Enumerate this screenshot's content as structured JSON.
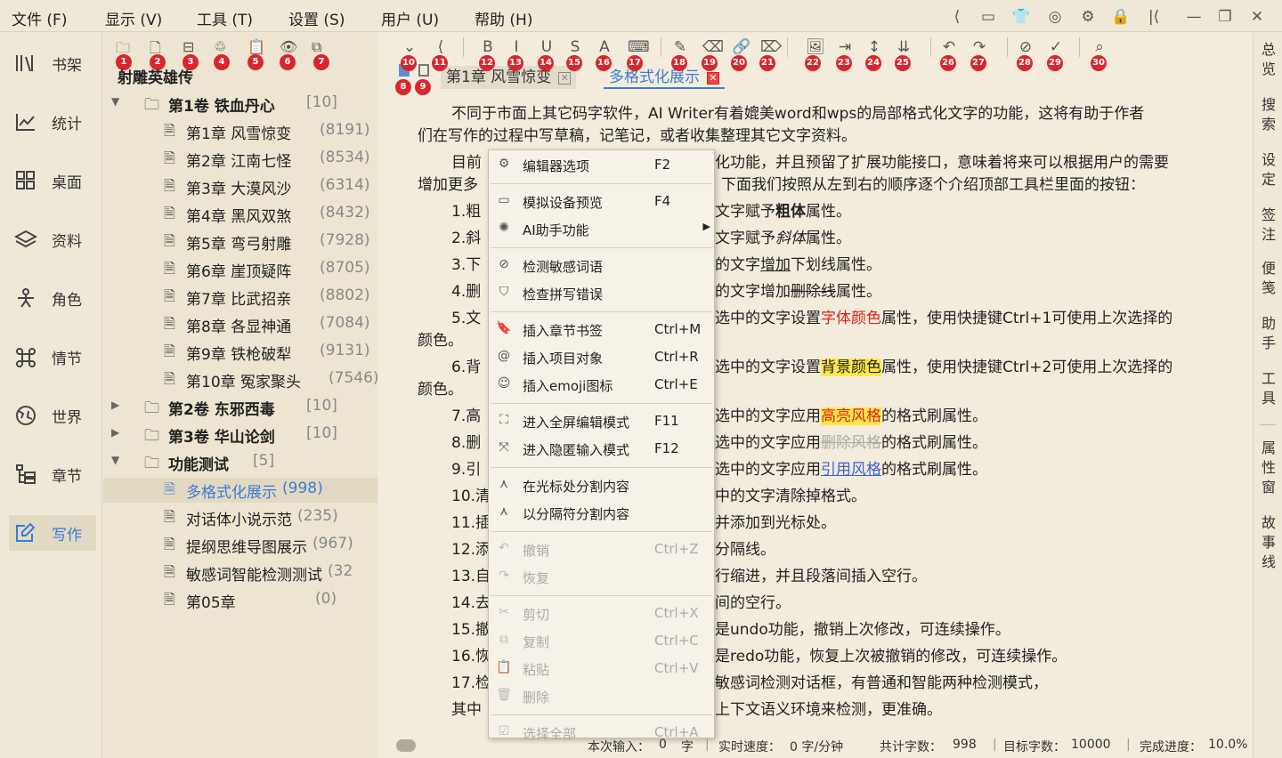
{
  "menu": [
    "文件 (F)",
    "显示 (V)",
    "工具 (T)",
    "设置 (S)",
    "用户 (U)",
    "帮助 (H)"
  ],
  "window_icons": [
    "first-page-icon",
    "sidebar-toggle-icon",
    "shirt-icon",
    "user-circle-icon",
    "gear-icon",
    "lock-icon",
    "collapse-icon",
    "minimize-icon",
    "maximize-icon",
    "close-icon"
  ],
  "nav": [
    {
      "label": "书架",
      "icon": "bookshelf-icon"
    },
    {
      "label": "统计",
      "icon": "chart-icon"
    },
    {
      "label": "桌面",
      "icon": "desktop-icon"
    },
    {
      "label": "资料",
      "icon": "layers-icon"
    },
    {
      "label": "角色",
      "icon": "person-icon"
    },
    {
      "label": "情节",
      "icon": "command-icon"
    },
    {
      "label": "世界",
      "icon": "globe-icon"
    },
    {
      "label": "章节",
      "icon": "chapters-icon"
    },
    {
      "label": "写作",
      "icon": "write-icon"
    }
  ],
  "tree_toolbar_badges": [
    "1",
    "2",
    "3",
    "4",
    "5",
    "6",
    "7"
  ],
  "book_title": "射雕英雄传",
  "tree": [
    {
      "type": "volume",
      "expanded": true,
      "label": "第1卷 铁血丹心",
      "count": "[10]"
    },
    {
      "type": "chapter",
      "label": "第1章 风雪惊变",
      "count": "(8191)"
    },
    {
      "type": "chapter",
      "label": "第2章 江南七怪",
      "count": "(8534)"
    },
    {
      "type": "chapter",
      "label": "第3章 大漠风沙",
      "count": "(6314)"
    },
    {
      "type": "chapter",
      "label": "第4章 黑风双煞",
      "count": "(8432)"
    },
    {
      "type": "chapter",
      "label": "第5章 弯弓射雕",
      "count": "(7928)"
    },
    {
      "type": "chapter",
      "label": "第6章 崖顶疑阵",
      "count": "(8705)"
    },
    {
      "type": "chapter",
      "label": "第7章 比武招亲",
      "count": "(8802)"
    },
    {
      "type": "chapter",
      "label": "第8章 各显神通",
      "count": "(7084)"
    },
    {
      "type": "chapter",
      "label": "第9章 铁枪破犁",
      "count": "(9131)"
    },
    {
      "type": "chapter",
      "label": "第10章 冤家聚头",
      "count": "(7546)"
    },
    {
      "type": "volume",
      "expanded": false,
      "label": "第2卷 东邪西毒",
      "count": "[10]"
    },
    {
      "type": "volume",
      "expanded": false,
      "label": "第3卷 华山论剑",
      "count": "[10]"
    },
    {
      "type": "volume",
      "expanded": true,
      "label": "功能测试",
      "count": "[5]"
    },
    {
      "type": "chapter",
      "selected": true,
      "label": "多格式化展示",
      "count": "(998)"
    },
    {
      "type": "chapter",
      "label": "对话体小说示范",
      "count": "(235)"
    },
    {
      "type": "chapter",
      "label": "提纲思维导图展示",
      "count": "(967)"
    },
    {
      "type": "chapter",
      "label": "敏感词智能检测测试",
      "count": "(32"
    },
    {
      "type": "chapter",
      "label": "第05章",
      "count": "(0)"
    }
  ],
  "editor_toolbar_badges": [
    "10",
    "11",
    "12",
    "13",
    "14",
    "15",
    "16",
    "17",
    "18",
    "19",
    "20",
    "21",
    "22",
    "23",
    "24",
    "25",
    "26",
    "27",
    "28",
    "29",
    "30"
  ],
  "tab_badges": [
    "8",
    "9"
  ],
  "tabs": [
    {
      "label": "第1章 风雪惊变",
      "active": false
    },
    {
      "label": "多格式化展示",
      "active": true
    }
  ],
  "editor": {
    "p1a": "不同于市面上其它码字软件，AI Writer有着媲美word和wps的局部格式化文字的功能，这将有助于作者",
    "p1b": "们在写作的过程中写草稿，记笔记，或者收集整理其它文字资料。",
    "p2a_left": "目前",
    "p2a_right": "化功能，并且预留了扩展功能接口，意味着将来可以根据用户的需要",
    "p2b_left": "增加更多",
    "p2b_right": "下面我们按照从左到右的顺序逐个介绍顶部工具栏里面的按钮：",
    "lines": [
      {
        "left": "1.粗",
        "right_pre": "文字赋予",
        "right_mark": "粗体",
        "right_post": "属性。",
        "style": "bold"
      },
      {
        "left": "2.斜",
        "right_pre": "文字赋予",
        "right_mark": "斜体",
        "right_post": "属性。",
        "style": "italic"
      },
      {
        "left": "3.下",
        "right_pre": "的文字",
        "right_mark": "增加",
        "right_post": "下划线属性。",
        "style": "underline"
      },
      {
        "left": "4.删",
        "right_pre": "的文字增加",
        "right_mark": "删除线",
        "right_post": "属性。",
        "style": "strike"
      },
      {
        "left": "5.文",
        "right_pre": "选中的文字设置",
        "right_mark": "字体颜色",
        "right_post": "属性，使用快捷键Ctrl+1可使用上次选择的",
        "style": "color"
      },
      {
        "left": "颜色。",
        "right_pre": "",
        "right_mark": "",
        "right_post": "",
        "style": "none"
      },
      {
        "left": "6.背",
        "right_pre": "选中的文字设置",
        "right_mark": "背景颜色",
        "right_post": "属性，使用快捷键Ctrl+2可使用上次选择的",
        "style": "bg"
      },
      {
        "left": "颜色。",
        "right_pre": "",
        "right_mark": "",
        "right_post": "",
        "style": "none"
      },
      {
        "left": "7.高",
        "right_pre": "选中的文字应用",
        "right_mark": "高亮风格",
        "right_post": "的格式刷属性。",
        "style": "highlight"
      },
      {
        "left": "8.删",
        "right_pre": "选中的文字应用",
        "right_mark": "删除风格",
        "right_post": "的格式刷属性。",
        "style": "delstyle"
      },
      {
        "left": "9.引",
        "right_pre": "选中的文字应用",
        "right_mark": "引用风格",
        "right_post": "的格式刷属性。",
        "style": "quote"
      },
      {
        "left": "10.清",
        "right_pre": "中的文字清除掉格式。",
        "right_mark": "",
        "right_post": "",
        "style": "none"
      },
      {
        "left": "11.插",
        "right_pre": "并添加到光标处。",
        "right_mark": "",
        "right_post": "",
        "style": "none"
      },
      {
        "left": "12.添",
        "right_pre": "分隔线。",
        "right_mark": "",
        "right_post": "",
        "style": "none"
      },
      {
        "left": "13.自",
        "right_pre": "行缩进，并且段落间插入空行。",
        "right_mark": "",
        "right_post": "",
        "style": "none"
      },
      {
        "left": "14.去",
        "right_pre": "间的空行。",
        "right_mark": "",
        "right_post": "",
        "style": "none"
      },
      {
        "left": "15.撤",
        "right_pre": "是undo功能，撤销上次修改，可连续操作。",
        "right_mark": "",
        "right_post": "",
        "style": "none"
      },
      {
        "left": "16.恢",
        "right_pre": "是redo功能，恢复上次被撤销的修改，可连续操作。",
        "right_mark": "",
        "right_post": "",
        "style": "none"
      },
      {
        "left": "17.检",
        "right_pre": "敏感词检测对话框，有普通和智能两种检测模式，",
        "right_mark": "",
        "right_post": "",
        "style": "none"
      },
      {
        "left": "其中",
        "right_pre": "上下文语义环境来检测，更准确。",
        "right_mark": "",
        "right_post": "",
        "style": "none"
      }
    ]
  },
  "context_menu": [
    {
      "label": "编辑器选项",
      "shortcut": "F2",
      "icon": "settings-icon",
      "disabled": false
    },
    {
      "sep": true
    },
    {
      "label": "模拟设备预览",
      "shortcut": "F4",
      "icon": "device-icon",
      "disabled": false
    },
    {
      "label": "AI助手功能",
      "shortcut": "",
      "icon": "ai-icon",
      "disabled": false,
      "submenu": true
    },
    {
      "sep": true
    },
    {
      "label": "检测敏感词语",
      "shortcut": "",
      "icon": "ban-icon",
      "disabled": false
    },
    {
      "label": "检查拼写错误",
      "shortcut": "",
      "icon": "shield-check-icon",
      "disabled": false
    },
    {
      "sep": true
    },
    {
      "label": "插入章节书签",
      "shortcut": "Ctrl+M",
      "icon": "bookmark-icon",
      "disabled": false
    },
    {
      "label": "插入项目对象",
      "shortcut": "Ctrl+R",
      "icon": "at-icon",
      "disabled": false
    },
    {
      "label": "插入emoji图标",
      "shortcut": "Ctrl+E",
      "icon": "smile-icon",
      "disabled": false
    },
    {
      "sep": true
    },
    {
      "label": "进入全屏编辑模式",
      "shortcut": "F11",
      "icon": "fullscreen-icon",
      "disabled": false
    },
    {
      "label": "进入隐匿输入模式",
      "shortcut": "F12",
      "icon": "compress-icon",
      "disabled": false
    },
    {
      "sep": true
    },
    {
      "label": "在光标处分割内容",
      "shortcut": "",
      "icon": "split-icon",
      "disabled": false
    },
    {
      "label": "以分隔符分割内容",
      "shortcut": "",
      "icon": "split-icon",
      "disabled": false
    },
    {
      "sep": true
    },
    {
      "label": "撤销",
      "shortcut": "Ctrl+Z",
      "icon": "undo-icon",
      "disabled": true
    },
    {
      "label": "恢复",
      "shortcut": "",
      "icon": "redo-icon",
      "disabled": true
    },
    {
      "sep": true
    },
    {
      "label": "剪切",
      "shortcut": "Ctrl+X",
      "icon": "scissors-icon",
      "disabled": true
    },
    {
      "label": "复制",
      "shortcut": "Ctrl+C",
      "icon": "copy-icon",
      "disabled": true
    },
    {
      "label": "粘贴",
      "shortcut": "Ctrl+V",
      "icon": "paste-icon",
      "disabled": true
    },
    {
      "label": "删除",
      "shortcut": "",
      "icon": "trash-icon",
      "disabled": true
    },
    {
      "sep": true
    },
    {
      "label": "选择全部",
      "shortcut": "Ctrl+A",
      "icon": "select-all-icon",
      "disabled": true
    }
  ],
  "right_bar": [
    "总览",
    "搜索",
    "设定",
    "签注",
    "便笺",
    "助手",
    "工具",
    "属性窗",
    "故事线"
  ],
  "status": {
    "input_label": "本次输入：",
    "input_value": "0",
    "input_unit": "字",
    "speed_label": "实时速度：",
    "speed_value": "0 字/分钟",
    "total_label": "共计字数：",
    "total_value": "998",
    "target_label": "目标字数：",
    "target_value": "10000",
    "progress_label": "完成进度：",
    "progress_value": "10.0%"
  },
  "colors": {
    "accent": "#3a7bd5",
    "badge": "#d9262c",
    "font_color": "#e0201a",
    "bg_yellow": "#ffe94a",
    "quote_blue": "#3a62d0"
  }
}
